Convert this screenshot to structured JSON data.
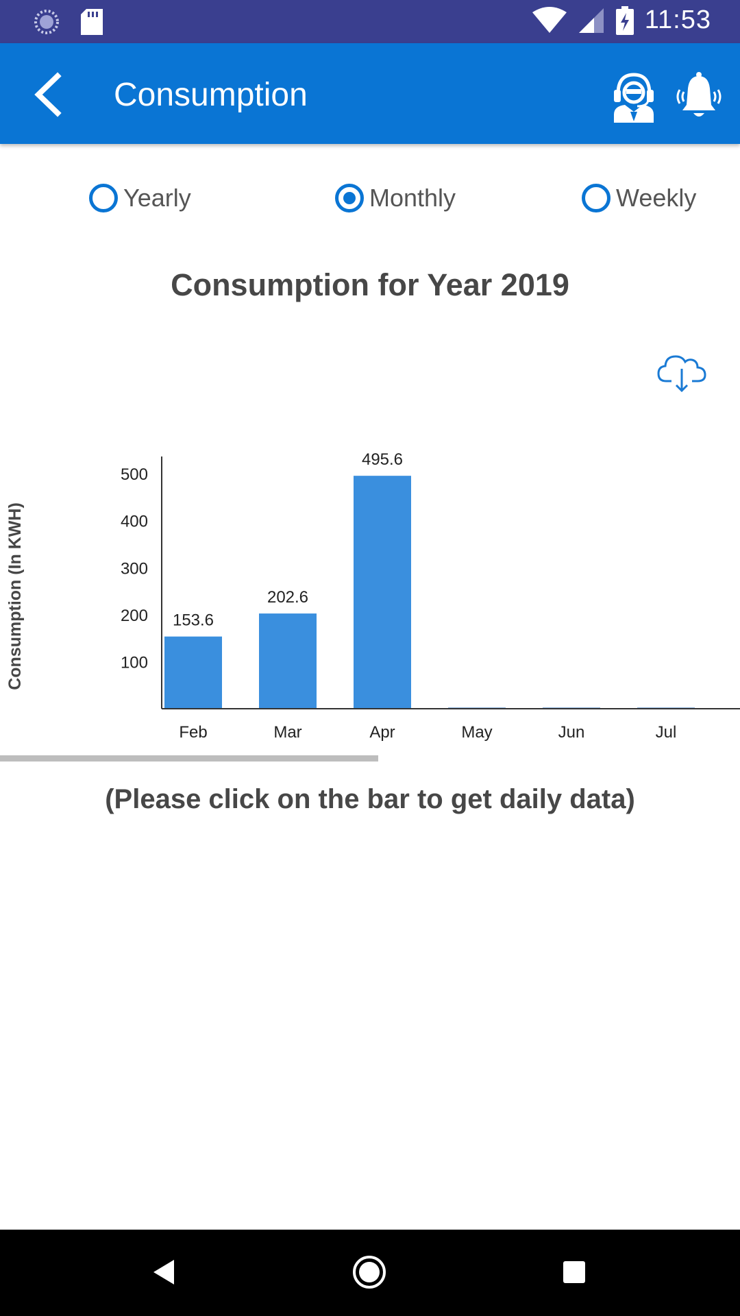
{
  "status_bar": {
    "time": "11:53",
    "icons": [
      "sync-icon",
      "sd-card-icon",
      "wifi-icon",
      "signal-icon",
      "battery-charging-icon"
    ]
  },
  "app_bar": {
    "title": "Consumption",
    "back_icon": "back-arrow-icon",
    "actions": [
      "support-agent-icon",
      "notification-bell-icon"
    ],
    "color": "#0a75d4"
  },
  "period_options": [
    {
      "label": "Yearly",
      "selected": false
    },
    {
      "label": "Monthly",
      "selected": true
    },
    {
      "label": "Weekly",
      "selected": false
    }
  ],
  "chart_heading": "Consumption for Year 2019",
  "download_icon": "cloud-download-icon",
  "hint_text": "(Please click on the bar to get daily data)",
  "chart_data": {
    "type": "bar",
    "categories": [
      "Feb",
      "Mar",
      "Apr",
      "May",
      "Jun",
      "Jul"
    ],
    "values": [
      153.6,
      202.6,
      495.6,
      0,
      0,
      0
    ],
    "data_labels": [
      "153.6",
      "202.6",
      "495.6",
      "",
      "",
      ""
    ],
    "ylabel": "Consumption (In KWH)",
    "yticks": [
      100,
      200,
      300,
      400,
      500
    ],
    "ylim": [
      0,
      560
    ],
    "bar_color": "#3a8fde",
    "grid": false
  },
  "nav_bar": {
    "buttons": [
      "nav-back-icon",
      "nav-home-icon",
      "nav-recents-icon"
    ]
  }
}
